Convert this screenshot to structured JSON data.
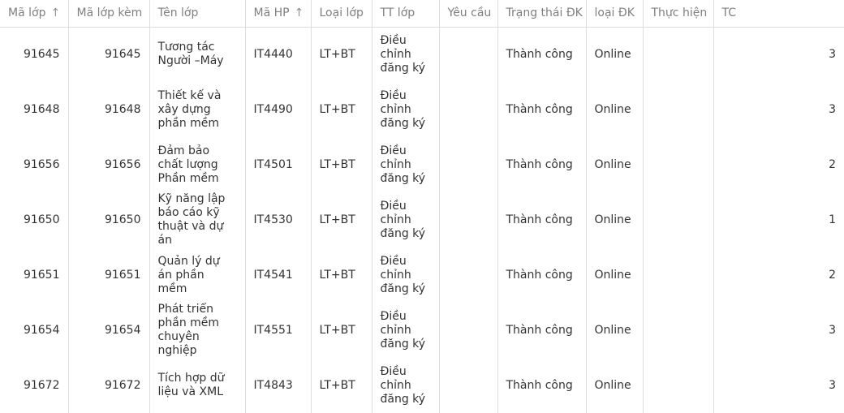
{
  "columns": [
    {
      "label": "Mã lớp",
      "sort_icon": "arrow-up-icon"
    },
    {
      "label": "Mã lớp kèm"
    },
    {
      "label": "Tên lớp"
    },
    {
      "label": "Mã HP",
      "sort_icon": "arrow-up-icon"
    },
    {
      "label": "Loại lớp"
    },
    {
      "label": "TT lớp"
    },
    {
      "label": "Yêu cầu"
    },
    {
      "label": "Trạng thái ĐK"
    },
    {
      "label": "loại ĐK"
    },
    {
      "label": "Thực hiện"
    },
    {
      "label": "TC"
    }
  ],
  "rows": [
    {
      "ma_lop": "91645",
      "ma_lop_kem": "91645",
      "ten_lop": "Tương tác Người –Máy",
      "ma_hp": "IT4440",
      "loai_lop": "LT+BT",
      "tt_lop": "Điều chỉnh đăng ký",
      "yeu_cau": "",
      "trang_thai_dk": "Thành công",
      "loai_dk": "Online",
      "thuc_hien": "",
      "tc": "3"
    },
    {
      "ma_lop": "91648",
      "ma_lop_kem": "91648",
      "ten_lop": "Thiết kế và xây dựng phần mềm",
      "ma_hp": "IT4490",
      "loai_lop": "LT+BT",
      "tt_lop": "Điều chỉnh đăng ký",
      "yeu_cau": "",
      "trang_thai_dk": "Thành công",
      "loai_dk": "Online",
      "thuc_hien": "",
      "tc": "3"
    },
    {
      "ma_lop": "91656",
      "ma_lop_kem": "91656",
      "ten_lop": "Đảm bảo chất lượng Phần mềm",
      "ma_hp": "IT4501",
      "loai_lop": "LT+BT",
      "tt_lop": "Điều chỉnh đăng ký",
      "yeu_cau": "",
      "trang_thai_dk": "Thành công",
      "loai_dk": "Online",
      "thuc_hien": "",
      "tc": "2"
    },
    {
      "ma_lop": "91650",
      "ma_lop_kem": "91650",
      "ten_lop": "Kỹ năng lập báo cáo kỹ thuật và dự án",
      "ma_hp": "IT4530",
      "loai_lop": "LT+BT",
      "tt_lop": "Điều chỉnh đăng ký",
      "yeu_cau": "",
      "trang_thai_dk": "Thành công",
      "loai_dk": "Online",
      "thuc_hien": "",
      "tc": "1"
    },
    {
      "ma_lop": "91651",
      "ma_lop_kem": "91651",
      "ten_lop": "Quản lý dự án phần mềm",
      "ma_hp": "IT4541",
      "loai_lop": "LT+BT",
      "tt_lop": "Điều chỉnh đăng ký",
      "yeu_cau": "",
      "trang_thai_dk": "Thành công",
      "loai_dk": "Online",
      "thuc_hien": "",
      "tc": "2"
    },
    {
      "ma_lop": "91654",
      "ma_lop_kem": "91654",
      "ten_lop": "Phát triển phần mềm chuyên nghiệp",
      "ma_hp": "IT4551",
      "loai_lop": "LT+BT",
      "tt_lop": "Điều chỉnh đăng ký",
      "yeu_cau": "",
      "trang_thai_dk": "Thành công",
      "loai_dk": "Online",
      "thuc_hien": "",
      "tc": "3"
    },
    {
      "ma_lop": "91672",
      "ma_lop_kem": "91672",
      "ten_lop": "Tích hợp dữ liệu và XML",
      "ma_hp": "IT4843",
      "loai_lop": "LT+BT",
      "tt_lop": "Điều chỉnh đăng ký",
      "yeu_cau": "",
      "trang_thai_dk": "Thành công",
      "loai_dk": "Online",
      "thuc_hien": "",
      "tc": "3"
    }
  ]
}
